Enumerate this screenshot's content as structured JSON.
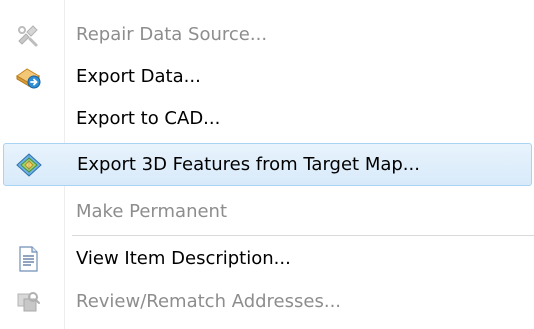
{
  "menu": {
    "items": [
      {
        "label": "Repair Data Source...",
        "icon": "repair-data-source-icon",
        "enabled": false
      },
      {
        "label": "Export Data...",
        "icon": "export-data-icon",
        "enabled": true
      },
      {
        "label": "Export to CAD...",
        "icon": "",
        "enabled": true
      },
      {
        "label": "Export 3D Features from Target Map...",
        "icon": "export-3d-features-icon",
        "enabled": true,
        "highlighted": true
      },
      {
        "label": "Make Permanent",
        "icon": "",
        "enabled": false
      },
      {
        "label": "View Item Description...",
        "icon": "item-description-icon",
        "enabled": true
      },
      {
        "label": "Review/Rematch Addresses...",
        "icon": "review-rematch-addresses-icon",
        "enabled": false
      }
    ]
  },
  "colors": {
    "disabled_text": "#8d8d8d",
    "highlight_border": "#a9d3f3",
    "highlight_fill": "#dfeefb"
  }
}
